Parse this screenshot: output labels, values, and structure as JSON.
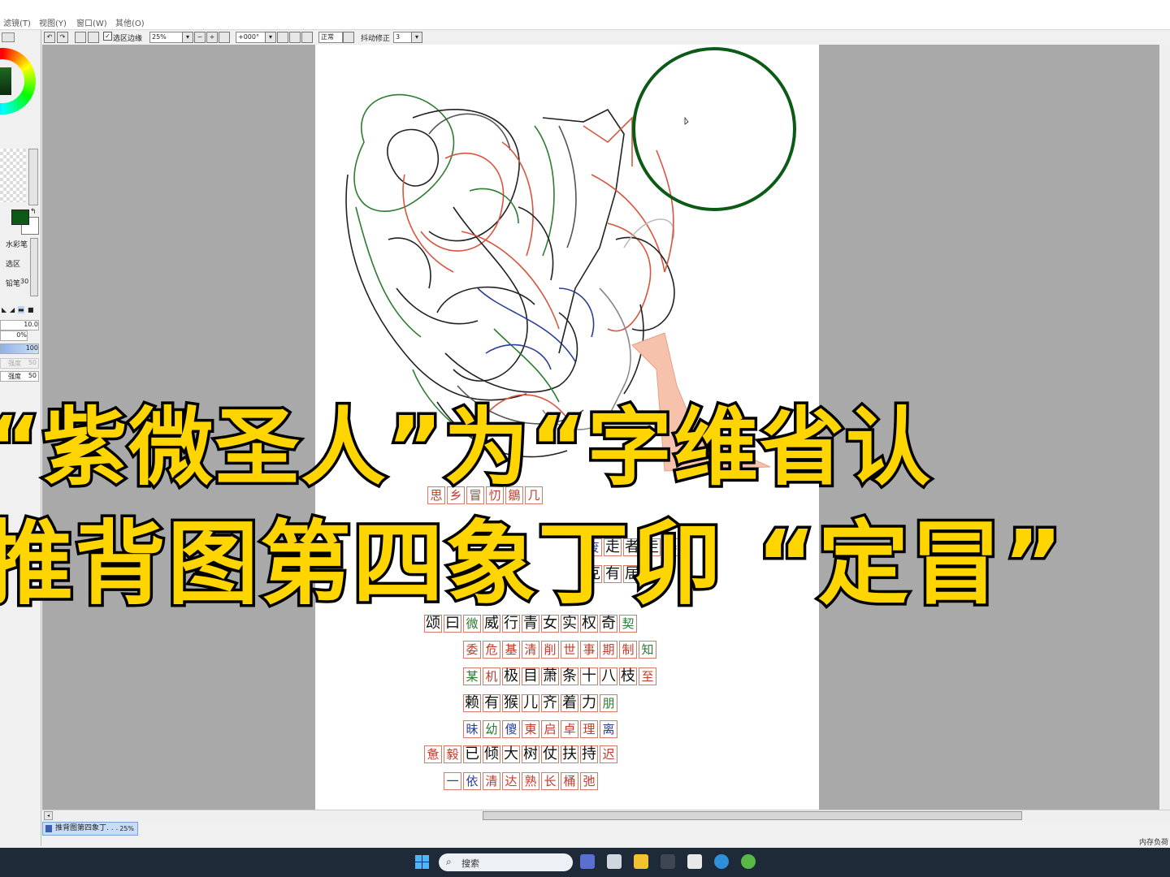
{
  "menu": {
    "filter": "滤镜(T)",
    "view": "视图(Y)",
    "window": "窗口(W)",
    "other": "其他(O)"
  },
  "toolbar": {
    "selection_edge": "选区边缘",
    "zoom": "25%",
    "rotation": "+000°",
    "blend": "正常",
    "stabilizer_label": "抖动修正",
    "stabilizer_value": "3"
  },
  "left_panel": {
    "primary_color": "#0b5a16",
    "secondary_color": "#ffffff",
    "tools": [
      "水彩笔",
      "选区",
      "铅笔"
    ],
    "tool_sizes": [
      "",
      "",
      "30"
    ],
    "brush_size": "10.0",
    "opacity": "0%",
    "density": "100",
    "strength_disabled_label": "强度",
    "strength_disabled_value": "50",
    "strength_label": "强度",
    "strength_value": "50"
  },
  "overlay": {
    "line1": "“紫微圣人”为“字维省认",
    "line2": "推背图第四象丁卯 “定冒”"
  },
  "grid_rows": [
    [
      [
        "思",
        "red"
      ],
      [
        "乡",
        "red"
      ],
      [
        "冒",
        "red"
      ],
      [
        "忉",
        "red"
      ],
      [
        "鶵",
        "red"
      ],
      [
        "几",
        "red"
      ]
    ],
    [
      [
        "废",
        "blu"
      ],
      [
        "走",
        "blk"
      ],
      [
        "者",
        "blk"
      ],
      [
        "走",
        "blk"
      ],
      [
        "秦",
        "red"
      ]
    ],
    [
      [
        "克",
        "blk"
      ],
      [
        "有",
        "blk"
      ],
      [
        "居",
        "blk"
      ]
    ],
    [
      [
        "颂",
        "blk"
      ],
      [
        "曰",
        "blk"
      ],
      [
        "微",
        "grn"
      ],
      [
        "威",
        "blk"
      ],
      [
        "行",
        "blk"
      ],
      [
        "青",
        "blk"
      ],
      [
        "女",
        "blk"
      ],
      [
        "实",
        "blk"
      ],
      [
        "权",
        "blk"
      ],
      [
        "奇",
        "blk"
      ],
      [
        "契",
        "grn"
      ]
    ],
    [
      [
        "委",
        "red"
      ],
      [
        "危",
        "red"
      ],
      [
        "基",
        "red"
      ],
      [
        "清",
        "red"
      ],
      [
        "削",
        "red"
      ],
      [
        "世",
        "red"
      ],
      [
        "事",
        "red"
      ],
      [
        "期",
        "red"
      ],
      [
        "制",
        "red"
      ],
      [
        "知",
        "grn"
      ]
    ],
    [
      [
        "某",
        "grn"
      ],
      [
        "机",
        "red"
      ],
      [
        "极",
        "blk"
      ],
      [
        "目",
        "blk"
      ],
      [
        "萧",
        "blk"
      ],
      [
        "条",
        "blk"
      ],
      [
        "十",
        "blk"
      ],
      [
        "八",
        "blk"
      ],
      [
        "枝",
        "blk"
      ],
      [
        "至",
        "red"
      ]
    ],
    [
      [
        "赖",
        "blk"
      ],
      [
        "有",
        "blk"
      ],
      [
        "猴",
        "blk"
      ],
      [
        "儿",
        "blk"
      ],
      [
        "齐",
        "blk"
      ],
      [
        "着",
        "blk"
      ],
      [
        "力",
        "blk"
      ],
      [
        "朋",
        "grn"
      ]
    ],
    [
      [
        "昧",
        "blu"
      ],
      [
        "幼",
        "grn"
      ],
      [
        "傻",
        "blu"
      ],
      [
        "東",
        "red"
      ],
      [
        "启",
        "red"
      ],
      [
        "卓",
        "red"
      ],
      [
        "理",
        "red"
      ],
      [
        "离",
        "blu"
      ]
    ],
    [
      [
        "惫",
        "red"
      ],
      [
        "毅",
        "red"
      ],
      [
        "已",
        "blk"
      ],
      [
        "倾",
        "blk"
      ],
      [
        "大",
        "blk"
      ],
      [
        "树",
        "blk"
      ],
      [
        "仗",
        "blk"
      ],
      [
        "扶",
        "blk"
      ],
      [
        "持",
        "blk"
      ],
      [
        "迟",
        "red"
      ]
    ],
    [
      [
        "一",
        "blu"
      ],
      [
        "依",
        "blu"
      ],
      [
        "清",
        "red"
      ],
      [
        "达",
        "red"
      ],
      [
        "熟",
        "red"
      ],
      [
        "长",
        "red"
      ],
      [
        "桶",
        "red"
      ],
      [
        "弛",
        "red"
      ]
    ]
  ],
  "document_tab": {
    "name": "推背图第四象丁. . .",
    "zoom": "25%"
  },
  "status": {
    "memory": "内存负荷"
  },
  "taskbar": {
    "search_placeholder": "搜索"
  },
  "colors": {
    "circle_stroke": "#0b5a16",
    "overlay_text": "#ffd500",
    "overlay_stroke": "#000000",
    "grid_border": "#d57a64"
  }
}
